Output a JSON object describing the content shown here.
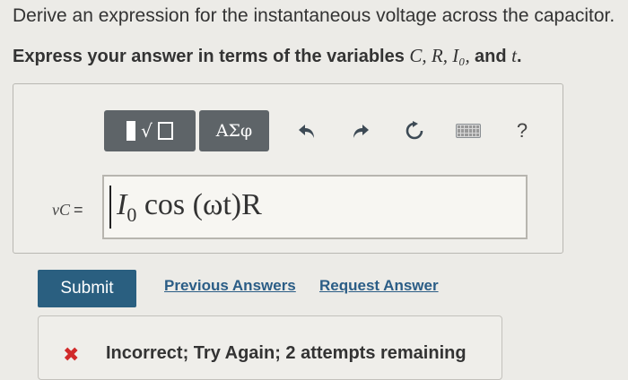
{
  "question": {
    "prompt": "Derive an expression for the instantaneous voltage across the capacitor.",
    "instruction_prefix": "Express your answer in terms of the variables ",
    "instruction_vars": "C, R, I₀, ",
    "instruction_and": "and ",
    "instruction_t": "t",
    "instruction_end": "."
  },
  "toolbar": {
    "templates_icon": "templates-icon",
    "symbols_label": "ΑΣφ",
    "undo_icon": "undo-icon",
    "redo_icon": "redo-icon",
    "reset_icon": "reset-icon",
    "keyboard_icon": "keyboard-icon",
    "help_label": "?"
  },
  "answer": {
    "variable": "vC",
    "equals": "=",
    "expr_I": "I",
    "expr_sub": "0",
    "expr_rest": " cos (ωt)R"
  },
  "actions": {
    "submit": "Submit",
    "previous_answers": "Previous Answers",
    "request_answer": "Request Answer"
  },
  "feedback": {
    "icon": "x-icon",
    "text": "Incorrect; Try Again; 2 attempts remaining",
    "color": "#d12a2a"
  },
  "colors": {
    "submit_bg": "#2a5f80",
    "link": "#2b5d86",
    "toolbar_bg": "#5e6468"
  }
}
